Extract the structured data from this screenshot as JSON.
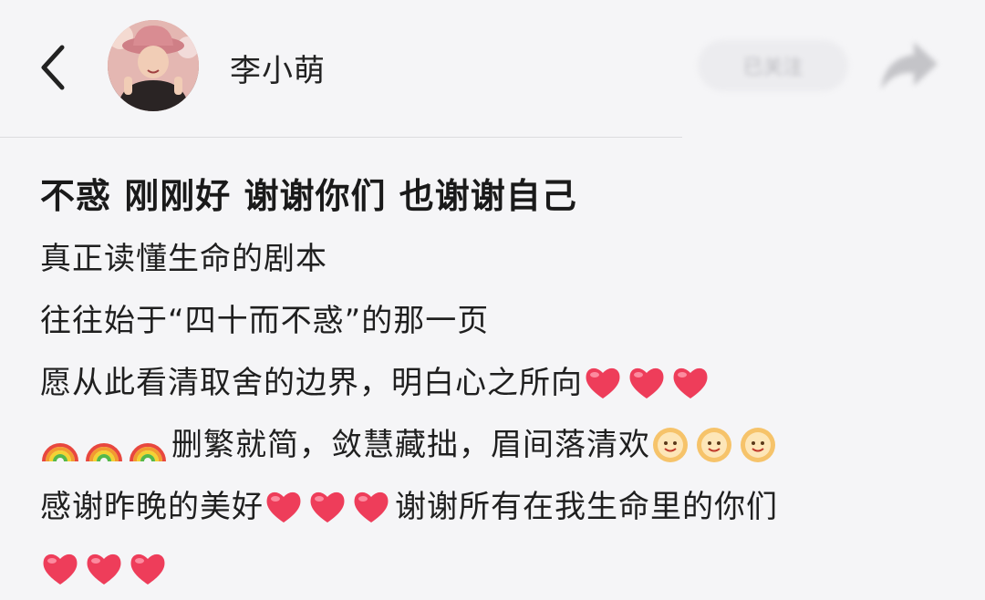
{
  "header": {
    "user_name": "李小萌",
    "follow_label": "已关注"
  },
  "post": {
    "title": "不惑 刚刚好 谢谢你们 也谢谢自己",
    "lines": [
      "真正读懂生命的剧本",
      "往往始于“四十而不惑”的那一页",
      "愿从此看清取舍的边界，明白心之所向",
      "删繁就简，敛慧藏拙，眉间落清欢",
      "感谢昨晚的美好",
      "谢谢所有在我生命里的你们"
    ]
  },
  "colors": {
    "heart": "#ee3d5a",
    "background": "#f5f5f7",
    "text": "#1f1f1f"
  }
}
